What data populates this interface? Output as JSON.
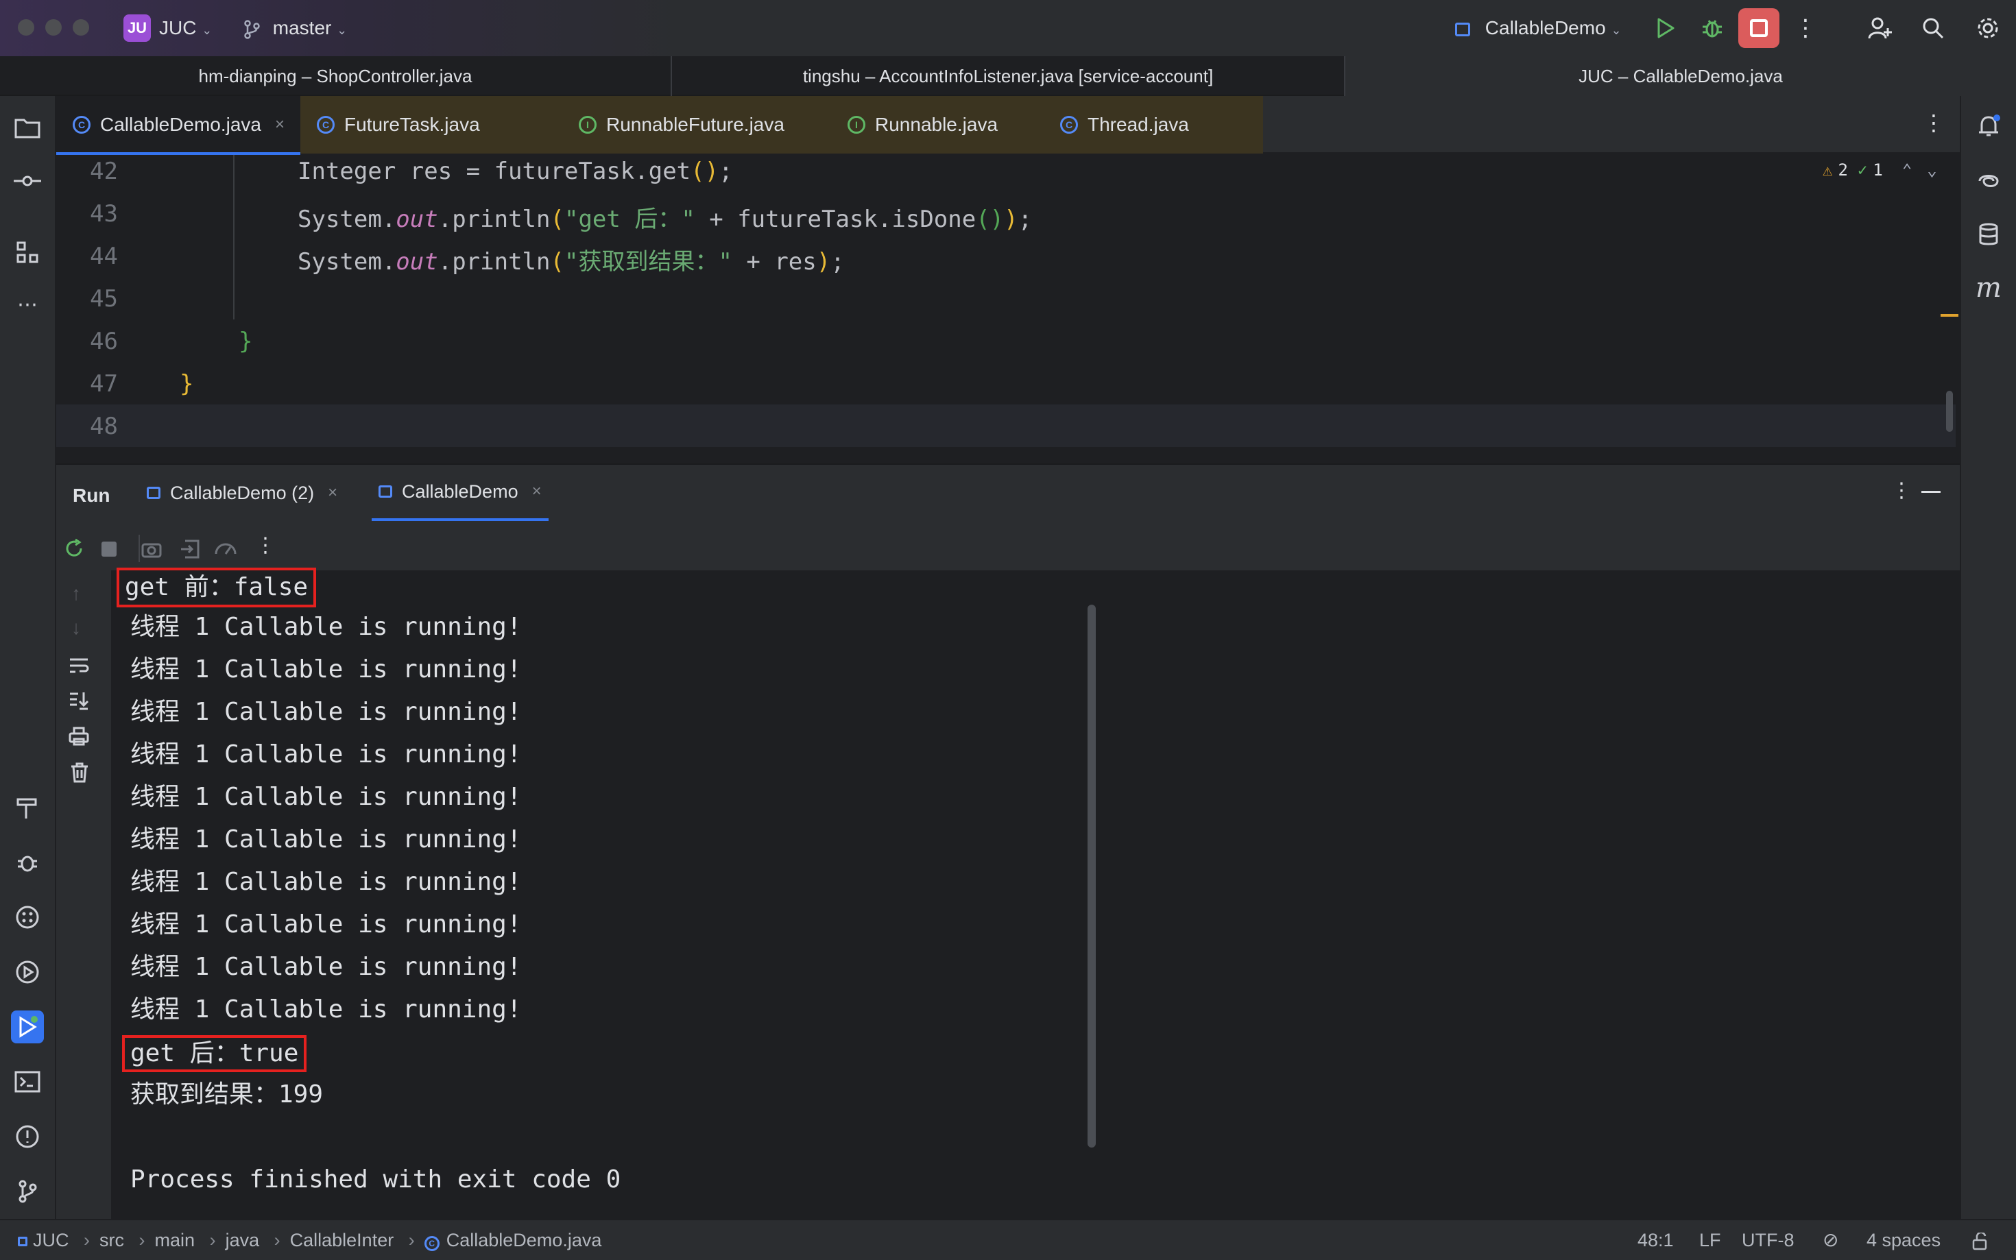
{
  "titlebar": {
    "project_badge": "JU",
    "project_name": "JUC",
    "branch": "master",
    "run_config": "CallableDemo"
  },
  "window_tabs": [
    {
      "label": "hm-dianping – ShopController.java"
    },
    {
      "label": "tingshu – AccountInfoListener.java [service-account]"
    },
    {
      "label": "JUC – CallableDemo.java"
    }
  ],
  "editor_tabs": [
    {
      "label": "CallableDemo.java",
      "kind": "class",
      "close": "×"
    },
    {
      "label": "FutureTask.java",
      "kind": "class"
    },
    {
      "label": "RunnableFuture.java",
      "kind": "interface"
    },
    {
      "label": "Runnable.java",
      "kind": "interface"
    },
    {
      "label": "Thread.java",
      "kind": "class"
    }
  ],
  "inspections": {
    "warnings": "2",
    "ok": "1"
  },
  "code": {
    "lines": [
      "42",
      "43",
      "44",
      "45",
      "46",
      "47",
      "48"
    ],
    "l42_a": "Integer res = futureTask.get",
    "l42_p1": "()",
    "l42_b": ";",
    "l43_a": "System.",
    "l43_out": "out",
    "l43_b": ".println",
    "l43_p1": "(",
    "l43_str": "\"get 后：\"",
    "l43_c": " + futureTask.isDone",
    "l43_p2": "()",
    "l43_p3": ")",
    "l43_d": ";",
    "l44_a": "System.",
    "l44_out": "out",
    "l44_b": ".println",
    "l44_p1": "(",
    "l44_str": "\"获取到结果：\"",
    "l44_c": " + res",
    "l44_p2": ")",
    "l44_d": ";",
    "l46": "}",
    "l47": "}"
  },
  "run": {
    "title": "Run",
    "tabs": [
      {
        "label": "CallableDemo (2)",
        "close": "×"
      },
      {
        "label": "CallableDemo",
        "close": "×"
      }
    ]
  },
  "console": {
    "lines": [
      "get 前：false",
      "线程 1 Callable is running!",
      "线程 1 Callable is running!",
      "线程 1 Callable is running!",
      "线程 1 Callable is running!",
      "线程 1 Callable is running!",
      "线程 1 Callable is running!",
      "线程 1 Callable is running!",
      "线程 1 Callable is running!",
      "线程 1 Callable is running!",
      "线程 1 Callable is running!",
      "get 后：true",
      "获取到结果：199",
      "",
      "Process finished with exit code 0"
    ]
  },
  "statusbar": {
    "breadcrumbs": [
      "JUC",
      "src",
      "main",
      "java",
      "CallableInter",
      "CallableDemo.java"
    ],
    "position": "48:1",
    "line_sep": "LF",
    "encoding": "UTF-8",
    "indent": "4 spaces"
  },
  "colors": {
    "accent": "#3574f0",
    "highlight_box": "#e5211f",
    "stop_button": "#db5c5c",
    "run_green": "#5fb865"
  }
}
